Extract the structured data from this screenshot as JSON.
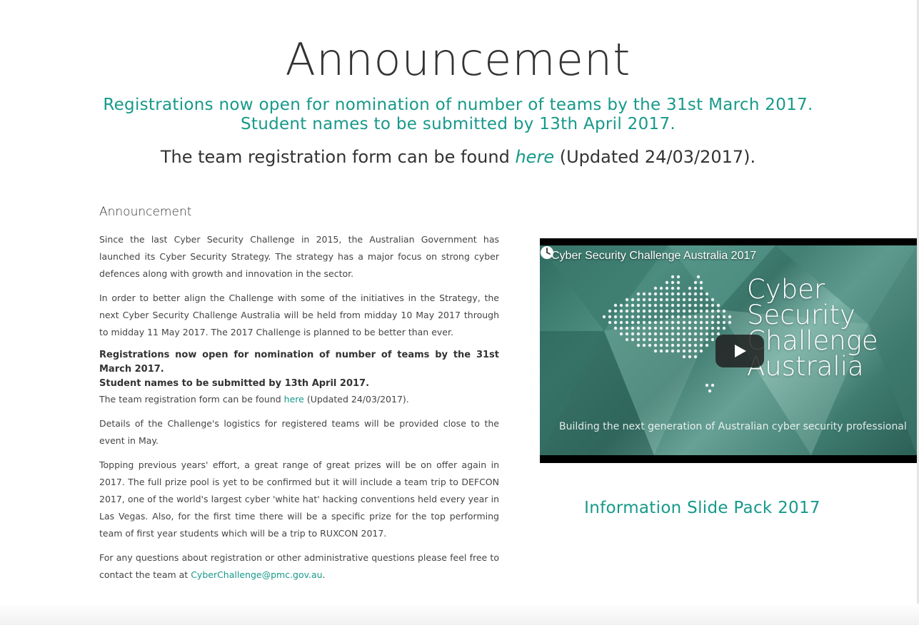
{
  "header": {
    "title": "Announcement",
    "reg_line1": "Registrations now open for nomination of number of teams by the 31st March 2017.",
    "reg_line2": "Student names to be submitted by 13th April 2017.",
    "form_prefix": "The team registration form can be found ",
    "form_link": "here",
    "form_suffix": " (Updated 24/03/2017)."
  },
  "content": {
    "subtitle": "Announcement",
    "p1": "Since the last Cyber Security Challenge in 2015, the Australian Government has launched its Cyber Security Strategy. The strategy has a major focus on strong cyber defences along with growth and innovation in the sector.",
    "p2": "In order to better align the Challenge with some of the initiatives in the Strategy, the next Cyber Security Challenge Australia will be held from midday 10 May 2017 through to midday 11 May 2017. The 2017 Challenge is planned to be better than ever.",
    "bold1": "Registrations now open for nomination of number of teams by the 31st March 2017.",
    "bold2": "Student names to be submitted by 13th April 2017.",
    "form_prefix": "The team registration form can be found ",
    "form_link": "here",
    "form_suffix": " (Updated 24/03/2017).",
    "p3": "Details of the Challenge's logistics for registered teams will be provided close to the event in May.",
    "p4": "Topping previous years' effort, a great range of great prizes will be on offer again in 2017. The full prize pool is yet to be confirmed but it will include a team trip to DEFCON 2017, one of the world's largest cyber 'white hat' hacking conventions held every year in Las Vegas. Also, for the first time there will be a specific prize for the top performing team of first year students which will be a trip to RUXCON 2017.",
    "p5_prefix": "For any questions about registration or other administrative questions please feel free to contact the team at ",
    "p5_link": "CyberChallenge@pmc.gov.au",
    "p5_suffix": "."
  },
  "video": {
    "title": "Cyber Security Challenge Australia 2017",
    "big_line1": "Cyber",
    "big_line2": "Security",
    "big_line3": "Challenge",
    "big_line4": "Australia",
    "tagline": "Building the next generation of Australian cyber security professional",
    "icons": [
      "clock-icon",
      "play-icon"
    ]
  },
  "sidebar": {
    "slide_pack": "Information Slide Pack 2017"
  },
  "colors": {
    "accent": "#17998a",
    "text": "#333333"
  }
}
